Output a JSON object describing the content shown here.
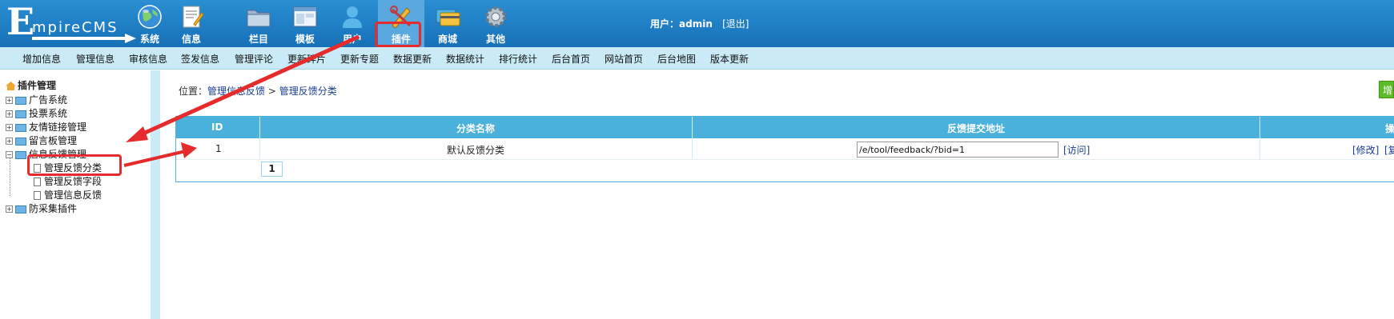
{
  "app": {
    "logo_initial": "E",
    "logo_rest": "mpireCMS"
  },
  "top_nav": [
    {
      "label": "系统",
      "icon": "globe-icon"
    },
    {
      "label": "信息",
      "icon": "document-icon"
    },
    {
      "label": "栏目",
      "icon": "folder-icon"
    },
    {
      "label": "模板",
      "icon": "window-icon"
    },
    {
      "label": "用户",
      "icon": "user-icon"
    },
    {
      "label": "插件",
      "icon": "tools-icon",
      "active": true
    },
    {
      "label": "商城",
      "icon": "cards-icon"
    },
    {
      "label": "其他",
      "icon": "gear-icon"
    }
  ],
  "user": {
    "prefix": "用户：",
    "name": "admin",
    "logout": "[退出]"
  },
  "sub_nav": [
    "增加信息",
    "管理信息",
    "审核信息",
    "签发信息",
    "管理评论",
    "更新碎片",
    "更新专题",
    "数据更新",
    "数据统计",
    "排行统计",
    "后台首页",
    "网站首页",
    "后台地图",
    "版本更新"
  ],
  "sidebar": {
    "title": "插件管理",
    "items": [
      "广告系统",
      "投票系统",
      "友情链接管理",
      "留言板管理",
      "信息反馈管理",
      "防采集插件"
    ],
    "sub_items": [
      "管理反馈分类",
      "管理反馈字段",
      "管理信息反馈"
    ]
  },
  "breadcrumb": {
    "prefix": "位置：",
    "crumb1": "管理信息反馈",
    "sep": " > ",
    "crumb2": "管理反馈分类"
  },
  "add_button": "增",
  "table": {
    "headers": [
      "ID",
      "分类名称",
      "反馈提交地址",
      "操"
    ],
    "rows": [
      {
        "id": "1",
        "name": "默认反馈分类",
        "url": "/e/tool/feedback/?bid=1",
        "visit": "[访问]",
        "edit": "[修改]",
        "copy": "[复"
      }
    ],
    "page": "1"
  },
  "colors": {
    "header": "#1c7ac1",
    "subnav": "#c9eaf6",
    "table_header": "#4ab0dc",
    "annotation": "#e52b2b"
  }
}
